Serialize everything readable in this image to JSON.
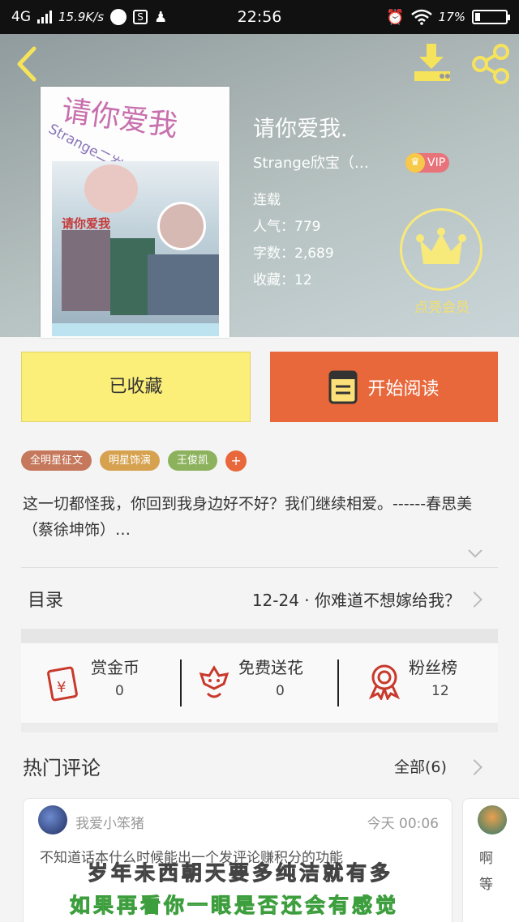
{
  "status_bar": {
    "network": "4G",
    "speed": "15.9K/s",
    "time": "22:56",
    "battery": "17%"
  },
  "header": {
    "cover_title": "请你爱我",
    "cover_subtitle": "Strange二岁〇看",
    "cover_heart_text": "请你爱我",
    "book_title": "请你爱我.",
    "author": "Strange欣宝（…",
    "vip_label": "VIP",
    "status": "连载",
    "popularity": "人气：779",
    "word_count": "字数：2,689",
    "favorites": "收藏：12",
    "member_label": "点亮会员"
  },
  "actions": {
    "favorited_label": "已收藏",
    "read_label": "开始阅读"
  },
  "tags": [
    {
      "label": "全明星征文",
      "color": "#c5785b"
    },
    {
      "label": "明星饰演",
      "color": "#d6a24f"
    },
    {
      "label": "王俊凯",
      "color": "#8db25d"
    }
  ],
  "tag_add": "+",
  "description": "这一切都怪我，你回到我身边好不好？我们继续相爱。------春思美（蔡徐坤饰）…",
  "toc": {
    "label": "目录",
    "latest": "12-24 · 你难道不想嫁给我？"
  },
  "stats": [
    {
      "label": "赏金币",
      "value": "0",
      "icon": "red-envelope-icon"
    },
    {
      "label": "免费送花",
      "value": "0",
      "icon": "flower-icon"
    },
    {
      "label": "粉丝榜",
      "value": "12",
      "icon": "medal-icon"
    }
  ],
  "comments": {
    "title": "热门评论",
    "all_label": "全部(6)",
    "items": [
      {
        "user": "我爱小笨猪",
        "time": "今天  00:06",
        "text": "不知道话本什么时候能出一个发评论赚积分的功能"
      },
      {
        "user": "",
        "time": "",
        "text": "啊等"
      }
    ]
  },
  "lyrics": {
    "line1": "岁年未西朝天要多纯洁就有多",
    "line2": "如果再看你一眼是否还会有感觉"
  },
  "colors": {
    "accent_orange": "#e8673b",
    "favorite_yellow": "#fbee79",
    "member_gold": "#f8e97b"
  }
}
